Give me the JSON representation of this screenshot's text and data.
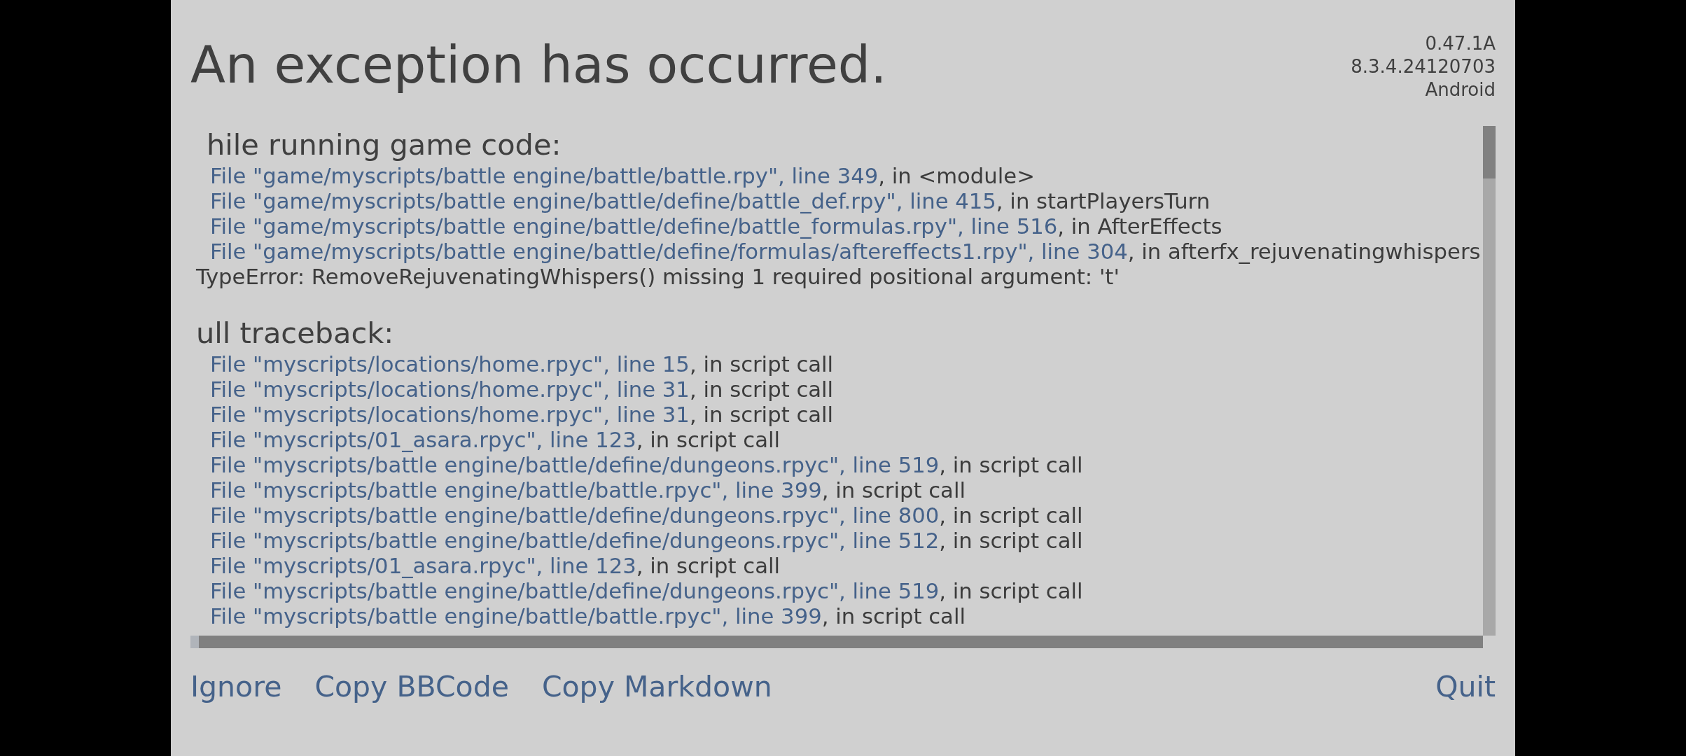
{
  "title": "An exception has occurred.",
  "version_info": [
    "0.47.1A",
    "8.3.4.24120703",
    "Android"
  ],
  "game_code": {
    "heading": "hile running game code:",
    "frames": [
      {
        "file": "File \"game/myscripts/battle engine/battle/battle.rpy\", line 349",
        "call": ", in <module>"
      },
      {
        "file": "File \"game/myscripts/battle engine/battle/define/battle_def.rpy\", line 415",
        "call": ", in startPlayersTurn"
      },
      {
        "file": "File \"game/myscripts/battle engine/battle/define/battle_formulas.rpy\", line 516",
        "call": ", in AfterEffects"
      },
      {
        "file": "File \"game/myscripts/battle engine/battle/define/formulas/aftereffects1.rpy\", line 304",
        "call": ", in afterfx_rejuvenatingwhispers"
      }
    ],
    "error": "TypeError: RemoveRejuvenatingWhispers() missing 1 required positional argument: 't'"
  },
  "full_traceback": {
    "heading": "ull traceback:",
    "frames": [
      {
        "file": "File \"myscripts/locations/home.rpyc\", line 15",
        "call": ", in script call"
      },
      {
        "file": "File \"myscripts/locations/home.rpyc\", line 31",
        "call": ", in script call"
      },
      {
        "file": "File \"myscripts/locations/home.rpyc\", line 31",
        "call": ", in script call"
      },
      {
        "file": "File \"myscripts/01_asara.rpyc\", line 123",
        "call": ", in script call"
      },
      {
        "file": "File \"myscripts/battle engine/battle/define/dungeons.rpyc\", line 519",
        "call": ", in script call"
      },
      {
        "file": "File \"myscripts/battle engine/battle/battle.rpyc\", line 399",
        "call": ", in script call"
      },
      {
        "file": "File \"myscripts/battle engine/battle/define/dungeons.rpyc\", line 800",
        "call": ", in script call"
      },
      {
        "file": "File \"myscripts/battle engine/battle/define/dungeons.rpyc\", line 512",
        "call": ", in script call"
      },
      {
        "file": "File \"myscripts/01_asara.rpyc\", line 123",
        "call": ", in script call"
      },
      {
        "file": "File \"myscripts/battle engine/battle/define/dungeons.rpyc\", line 519",
        "call": ", in script call"
      },
      {
        "file": "File \"myscripts/battle engine/battle/battle.rpyc\", line 399",
        "call": ", in script call"
      }
    ]
  },
  "buttons": [
    "Ignore",
    "Copy BBCode",
    "Copy Markdown"
  ],
  "quit_button": "Quit"
}
